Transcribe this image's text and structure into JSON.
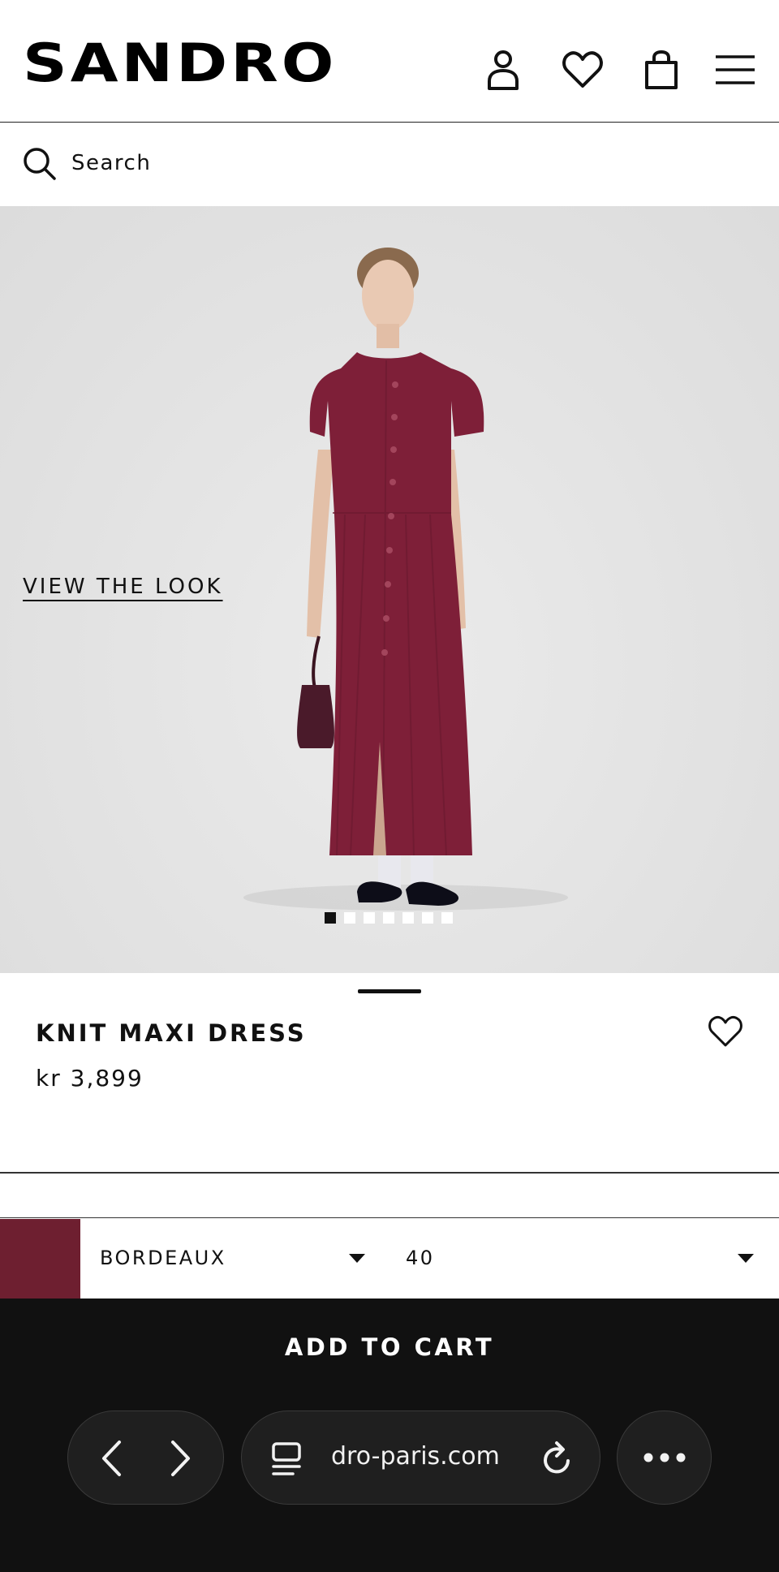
{
  "header": {
    "logo": "SANDRO",
    "icons": [
      "account-icon",
      "heart-icon",
      "bag-icon",
      "menu-icon"
    ]
  },
  "search": {
    "placeholder": "Search"
  },
  "hero": {
    "view_look_label": "VIEW THE LOOK",
    "carousel": {
      "total": 7,
      "active_index": 0
    },
    "colors": {
      "background": "#e3e3e3",
      "dress": "#7e1f38"
    }
  },
  "product": {
    "name": "KNIT MAXI DRESS",
    "price": "kr 3,899"
  },
  "selectors": {
    "color_swatch": "#6e1f30",
    "color_label": "BORDEAUX",
    "size_label": "40"
  },
  "cart": {
    "label": "ADD TO CART"
  },
  "browser": {
    "url": "dro-paris.com",
    "icons": [
      "back-icon",
      "forward-icon",
      "tabs-icon",
      "reload-icon",
      "more-icon"
    ]
  }
}
